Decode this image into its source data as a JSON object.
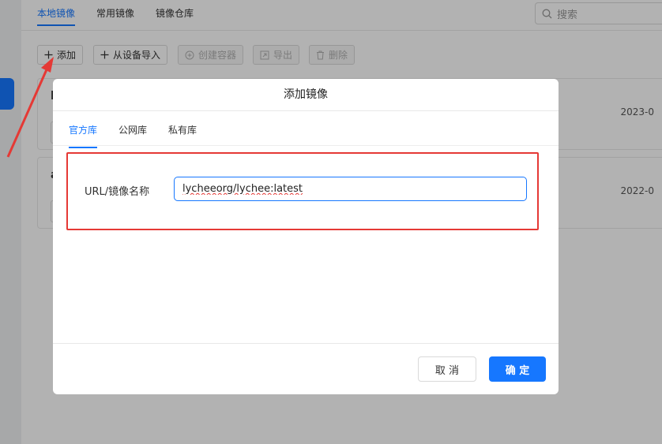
{
  "header": {
    "tabs": [
      {
        "label": "本地镜像",
        "active": true
      },
      {
        "label": "常用镜像",
        "active": false
      },
      {
        "label": "镜像仓库",
        "active": false
      }
    ],
    "search_placeholder": "搜索",
    "search_icon": "search-icon"
  },
  "toolbar": {
    "buttons": [
      {
        "label": "添加",
        "icon": "plus-icon",
        "disabled": false
      },
      {
        "label": "从设备导入",
        "icon": "plus-icon",
        "disabled": false
      },
      {
        "label": "创建容器",
        "icon": "plus-circle-icon",
        "disabled": true
      },
      {
        "label": "导出",
        "icon": "export-icon",
        "disabled": true
      },
      {
        "label": "删除",
        "icon": "trash-icon",
        "disabled": true
      }
    ]
  },
  "list": {
    "rows": [
      {
        "initial": "l",
        "date": "2023-0"
      },
      {
        "initial": "a",
        "date": "2022-0"
      }
    ]
  },
  "modal": {
    "title": "添加镜像",
    "tabs": [
      {
        "label": "官方库",
        "active": true
      },
      {
        "label": "公网库",
        "active": false
      },
      {
        "label": "私有库",
        "active": false
      }
    ],
    "field_label": "URL/镜像名称",
    "field_value": "lycheeorg/lychee:latest",
    "cancel_label": "取 消",
    "ok_label": "确 定"
  },
  "colors": {
    "accent": "#1677ff",
    "annotation_red": "#e53935"
  }
}
